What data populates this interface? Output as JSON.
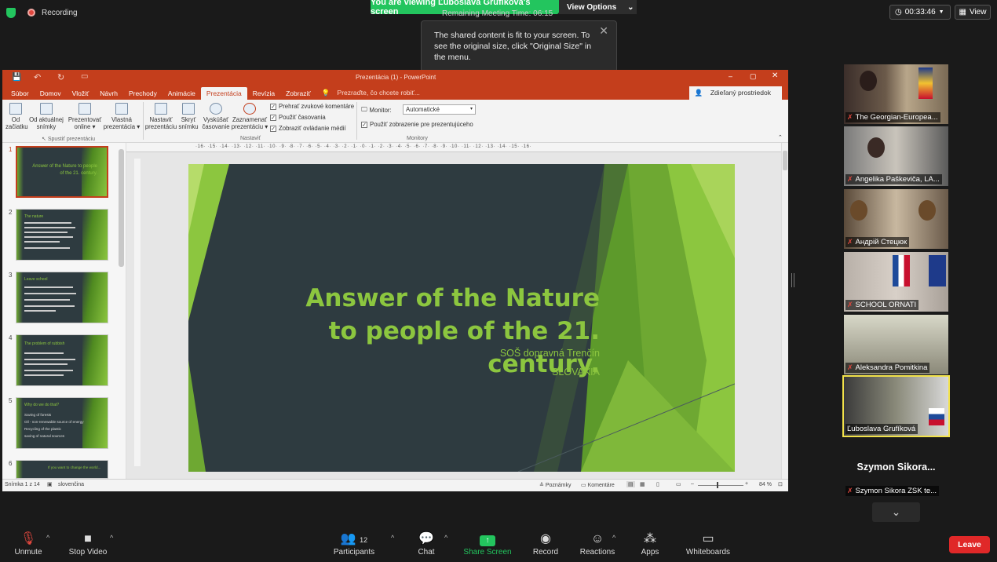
{
  "top": {
    "recording": "Recording",
    "viewing_banner": "You are viewing Ľuboslava Grufíková's screen",
    "view_options": "View Options",
    "meeting_time": "Remaining Meeting Time: 06:15",
    "tooltip": "The shared content is fit to your screen. To see the original size, click \"Original Size\" in the menu.",
    "timer": "00:33:46",
    "view": "View"
  },
  "ppt": {
    "window_title": "Prezentácia (1) - PowerPoint",
    "tabs": [
      "Súbor",
      "Domov",
      "Vložiť",
      "Návrh",
      "Prechody",
      "Animácie",
      "Prezentácia",
      "Revízia",
      "Zobraziť"
    ],
    "active_tab": "Prezentácia",
    "tell_me": "Prezraďte, čo chcete robiť...",
    "share": "Zdieľaný prostriedok",
    "ribbon": {
      "btn1": [
        "Od",
        "začiatku"
      ],
      "btn2": [
        "Od aktuálnej",
        "snímky"
      ],
      "btn3": [
        "Prezentovať",
        "online ▾"
      ],
      "btn4": [
        "Vlastná",
        "prezentácia ▾"
      ],
      "group1": "Spustiť prezentáciu",
      "btn5": [
        "Nastaviť",
        "prezentáciu"
      ],
      "btn6": [
        "Skryť",
        "snímku"
      ],
      "btn7": [
        "Vyskúšať",
        "časovanie"
      ],
      "btn8": [
        "Zaznamenať",
        "prezentáciu ▾"
      ],
      "group2": "Nastaviť",
      "chk1": "Prehrať zvukové komentáre",
      "chk2": "Použiť časovania",
      "chk3": "Zobraziť ovládanie médií",
      "monitor_label": "Monitor:",
      "monitor_value": "Automatické",
      "presenter_view": "Použiť zobrazenie pre prezentujúceho",
      "group3": "Monitory"
    },
    "ruler_h": "·16· ·15· ·14· ·13· ·12· ·11· ·10· ·9· ·8· ·7· ·6· ·5· ·4· ·3· ·2· ·1· ·0· ·1· ·2· ·3· ·4· ·5· ·6· ·7· ·8· ·9· ·10· ·11· ·12· ·13· ·14· ·15· ·16·",
    "thumbs": [
      {
        "num": "1",
        "title": "Answer of the Nature to people of the 21. century."
      },
      {
        "num": "2",
        "title": "The nature"
      },
      {
        "num": "3",
        "title": "Leave school"
      },
      {
        "num": "4",
        "title": "The problem of rubbish"
      },
      {
        "num": "5",
        "title": "Why do we do that?",
        "lines": [
          "Saving of forests",
          "Oil - non-renewable source of energy",
          "Recycling of the plastic",
          "saving of natural sources"
        ]
      },
      {
        "num": "6",
        "title": "If you want to change the world..."
      }
    ],
    "slide": {
      "title": "Answer of the Nature to people of the 21. century.",
      "sub1": "SOŠ dopravná Trenčín",
      "sub2": "SLOVAKIA"
    },
    "status": {
      "slide_count": "Snímka 1 z 14",
      "language": "slovenčina",
      "notes": "Poznámky",
      "comments": "Komentáre",
      "zoom": "84 %"
    }
  },
  "participants": [
    {
      "name": "The Georgian-Europea..."
    },
    {
      "name": "Angelika Paškeviča, LA..."
    },
    {
      "name": "Андрій Стецюк"
    },
    {
      "name": "SCHOOL ORNATI"
    },
    {
      "name": "Aleksandra Pomitkina"
    },
    {
      "name": "Ľuboslava Grufíková"
    },
    {
      "name": "Szymon Sikora...",
      "sub": "Szymon Sikora ZSK te..."
    }
  ],
  "toolbar": {
    "unmute": "Unmute",
    "stop_video": "Stop Video",
    "participants": "Participants",
    "participants_count": "12",
    "chat": "Chat",
    "share_screen": "Share Screen",
    "record": "Record",
    "reactions": "Reactions",
    "apps": "Apps",
    "whiteboards": "Whiteboards",
    "leave": "Leave"
  },
  "colors": {
    "zoom_green": "#23c55e",
    "ppt_red": "#c43e1c",
    "slide_green": "#8cc63f",
    "slide_bg": "#2e3b40",
    "leave_red": "#e02828"
  }
}
